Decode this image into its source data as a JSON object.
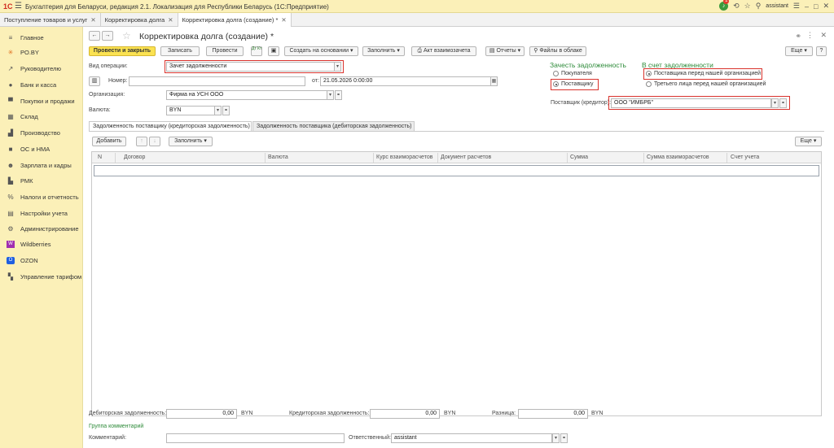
{
  "titlebar": {
    "logo": "1С",
    "title": "Бухгалтерия для Беларуси, редакция 2.1. Локализация для Республики Беларусь  (1С:Предприятие)",
    "notif_count": "1",
    "user": "assistant"
  },
  "tabs": [
    {
      "label": "Поступление товаров и услуг"
    },
    {
      "label": "Корректировка долга"
    },
    {
      "label": "Корректировка долга (создание) *"
    }
  ],
  "sidebar": [
    {
      "label": "Главное",
      "icon": "menu-icon"
    },
    {
      "label": "PO.BY",
      "icon": "star-icon"
    },
    {
      "label": "Руководителю",
      "icon": "chart-icon"
    },
    {
      "label": "Банк и касса",
      "icon": "bank-icon"
    },
    {
      "label": "Покупки и продажи",
      "icon": "cart-icon"
    },
    {
      "label": "Склад",
      "icon": "warehouse-icon"
    },
    {
      "label": "Производство",
      "icon": "factory-icon"
    },
    {
      "label": "ОС и НМА",
      "icon": "truck-icon"
    },
    {
      "label": "Зарплата и кадры",
      "icon": "people-icon"
    },
    {
      "label": "РМК",
      "icon": "register-icon"
    },
    {
      "label": "Налоги и отчетность",
      "icon": "percent-icon"
    },
    {
      "label": "Настройки учета",
      "icon": "settings-icon"
    },
    {
      "label": "Администрирование",
      "icon": "gear-icon"
    },
    {
      "label": "Wildberries",
      "icon": "wildberries-icon"
    },
    {
      "label": "OZON",
      "icon": "ozon-icon"
    },
    {
      "label": "Управление тарифом",
      "icon": "tariff-icon"
    }
  ],
  "header": {
    "title": "Корректировка долга (создание) *",
    "more_label": "Еще"
  },
  "toolbar": {
    "post_close": "Провести и закрыть",
    "save": "Записать",
    "post": "Провести",
    "dt_kt": "Дт Кт",
    "create_based": "Создать на основании",
    "fill": "Заполнить",
    "act": "Акт взаимозачета",
    "reports": "Отчеты",
    "files": "Файлы в облаке",
    "more": "Еще"
  },
  "form": {
    "operation_label": "Вид операции:",
    "operation_value": "Зачет задолженности",
    "number_label": "Номер:",
    "number_value": "",
    "date_label": "от:",
    "date_value": "21.05.2026  0:00:00",
    "org_label": "Организация:",
    "org_value": "Фирма на УСН ООО",
    "currency_label": "Валюта:",
    "currency_value": "BYN",
    "offset_title": "Зачесть задолженность",
    "offset_options": [
      "Покупателя",
      "Поставщику"
    ],
    "offset_selected": 1,
    "account_title": "В счет задолженности",
    "account_options": [
      "Поставщика перед нашей организацией",
      "Третьего лица перед нашей организацией"
    ],
    "account_selected": 0,
    "supplier_label": "Поставщик (кредитор):",
    "supplier_value": "ООО \"ИМБРБ\""
  },
  "form_tabs": [
    {
      "label": "Задолженность поставщику (кредиторская задолженность)"
    },
    {
      "label": "Задолженность поставщика (дебиторская задолженность)"
    }
  ],
  "grid_toolbar": {
    "add": "Добавить",
    "fill": "Заполнить",
    "more": "Еще"
  },
  "grid_columns": [
    "N",
    "Договор",
    "Валюта",
    "Курс взаиморасчетов",
    "Документ расчетов",
    "Сумма",
    "Сумма взаиморасчетов",
    "Счет учета"
  ],
  "footer": {
    "debit_label": "Дебиторская задолженность:",
    "debit_value": "0,00",
    "credit_label": "Кредиторская задолженность:",
    "credit_value": "0,00",
    "diff_label": "Разница:",
    "diff_value": "0,00",
    "currency": "BYN",
    "comments_group": "Группа комментарий",
    "comment_label": "Комментарий:",
    "comment_value": "",
    "responsible_label": "Ответственный:",
    "responsible_value": "assistant"
  }
}
